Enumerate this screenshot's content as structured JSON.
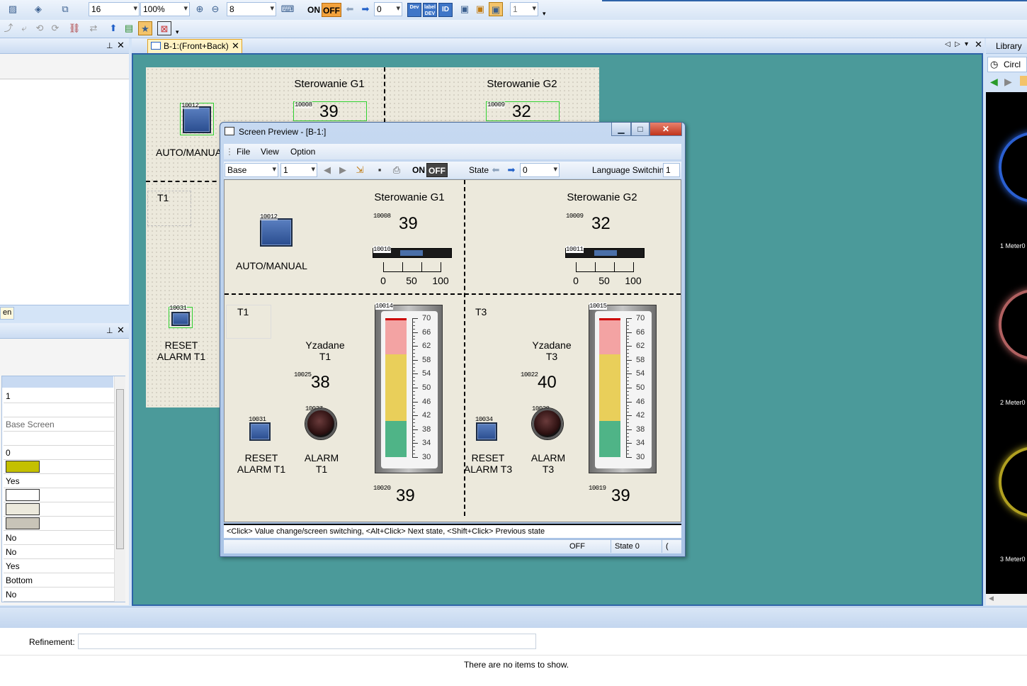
{
  "toolbar": {
    "font_size": "16",
    "zoom": "100%",
    "grid": "8",
    "on_label": "ON",
    "off_label": "OFF",
    "state_value": "0",
    "page_value": "1",
    "dev_label": "Dev",
    "label_dev_label": "label DEV",
    "id_label": "ID"
  },
  "tab": {
    "label": "B-1:(Front+Back)"
  },
  "library": {
    "title": "Library",
    "search": "Circl",
    "meters": [
      "1 Meter0",
      "2 Meter0",
      "3 Meter0"
    ]
  },
  "left_panel": {
    "tab_fragment": "en"
  },
  "properties": {
    "rows": [
      "1",
      "",
      "Base Screen",
      "",
      "0",
      "",
      "Yes",
      "",
      "",
      "",
      "No",
      "No",
      "Yes",
      "Bottom",
      "No"
    ],
    "swatch_colors": [
      "#c4c000",
      "#ffffff",
      "#ece9dc",
      "#c8c4b8"
    ]
  },
  "design": {
    "g1_title": "Sterowanie G1",
    "g2_title": "Sterowanie G2",
    "id_10012": "10012",
    "id_10008": "10008",
    "id_10009": "10009",
    "g1_value": "39",
    "g2_value": "32",
    "auto_manual": "AUTO/MANUAL",
    "t1": "T1",
    "id_10031": "10031",
    "reset_alarm_t1": "RESET\nALARM T1"
  },
  "preview": {
    "title": "Screen Preview - [B-1:]",
    "menu": {
      "file": "File",
      "view": "View",
      "option": "Option"
    },
    "toolbar": {
      "screen_type": "Base",
      "screen_no": "1",
      "on": "ON",
      "off": "OFF",
      "state_label": "State",
      "state_value": "0",
      "lang_label": "Language Switching",
      "lang_value": "1"
    },
    "g1_title": "Sterowanie G1",
    "g2_title": "Sterowanie G2",
    "id_10012": "10012",
    "id_10008": "10008",
    "id_10009": "10009",
    "g1_value": "39",
    "g2_value": "32",
    "id_10010": "10010",
    "id_10011": "10011",
    "scale": [
      "0",
      "50",
      "100"
    ],
    "auto_manual": "AUTO/MANUAL",
    "t1": "T1",
    "t3": "T3",
    "yzadane_t1": "Yzadane\nT1",
    "yzadane_t3": "Yzadane\nT3",
    "id_10025": "10025",
    "id_10022": "10022",
    "t1_set": "38",
    "t3_set": "40",
    "id_10031": "10031",
    "id_10027": "10027",
    "id_10034": "10034",
    "id_10028": "10028",
    "reset_alarm_t1": "RESET\nALARM T1",
    "alarm_t1": "ALARM\nT1",
    "reset_alarm_t3": "RESET\nALARM T3",
    "alarm_t3": "ALARM\nT3",
    "id_10014": "10014",
    "id_10015": "10015",
    "therm_scale": [
      "70",
      "66",
      "62",
      "58",
      "54",
      "50",
      "46",
      "42",
      "38",
      "34",
      "30"
    ],
    "id_10020": "10020",
    "id_10019": "10019",
    "t1_actual": "39",
    "t3_actual": "39",
    "hint": "<Click> Value change/screen switching, <Alt+Click> Next state, <Shift+Click> Previous state",
    "status_off": "OFF",
    "status_state": "State 0",
    "status_extra": "("
  },
  "bottom": {
    "refinement_label": "Refinement:",
    "refinement_value": "",
    "no_items": "There are no items to show."
  }
}
